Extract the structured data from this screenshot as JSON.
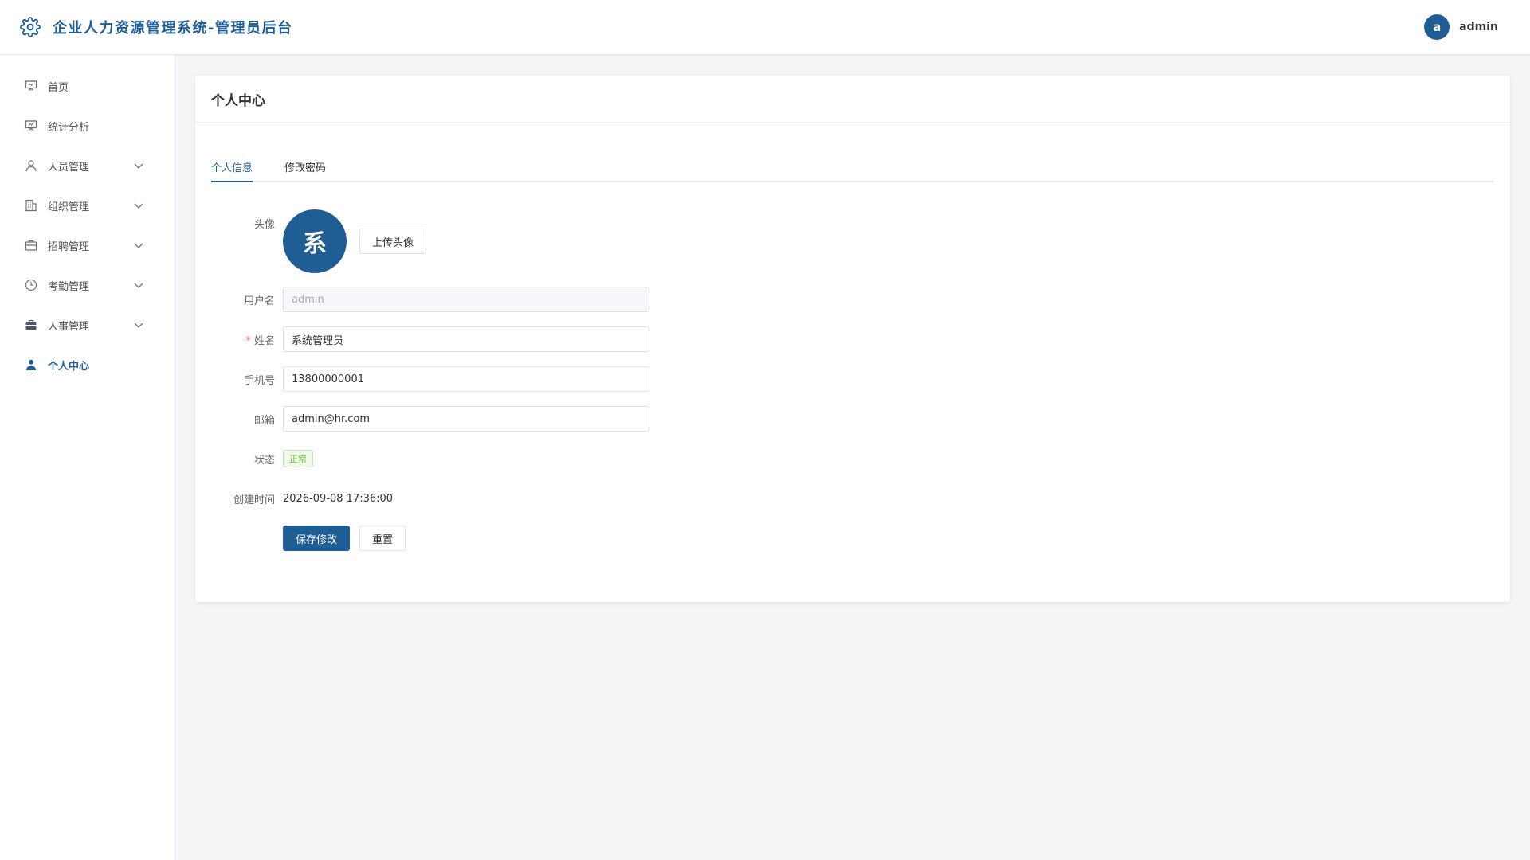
{
  "header": {
    "title": "企业人力资源管理系统-管理员后台",
    "logo_icon": "gear-icon",
    "user": {
      "avatar_letter": "a",
      "name": "admin"
    }
  },
  "sidebar": {
    "items": [
      {
        "label": "首页",
        "icon": "presentation-icon",
        "expandable": false
      },
      {
        "label": "统计分析",
        "icon": "presentation-chart-icon",
        "expandable": false
      },
      {
        "label": "人员管理",
        "icon": "user-icon",
        "expandable": true
      },
      {
        "label": "组织管理",
        "icon": "building-icon",
        "expandable": true
      },
      {
        "label": "招聘管理",
        "icon": "briefcase-icon",
        "expandable": true
      },
      {
        "label": "考勤管理",
        "icon": "clock-icon",
        "expandable": true
      },
      {
        "label": "人事管理",
        "icon": "toolbox-icon",
        "expandable": true
      },
      {
        "label": "个人中心",
        "icon": "user-filled-icon",
        "expandable": false,
        "active": true
      }
    ]
  },
  "card": {
    "title": "个人中心",
    "tabs": [
      {
        "label": "个人信息",
        "active": true
      },
      {
        "label": "修改密码",
        "active": false
      }
    ]
  },
  "form": {
    "avatar": {
      "label": "头像",
      "char": "系",
      "upload_button": "上传头像"
    },
    "username": {
      "label": "用户名",
      "value": "admin"
    },
    "name": {
      "label": "姓名",
      "required_mark": "*",
      "value": "系统管理员"
    },
    "phone": {
      "label": "手机号",
      "value": "13800000001"
    },
    "email": {
      "label": "邮箱",
      "value": "admin@hr.com"
    },
    "status": {
      "label": "状态",
      "value": "正常"
    },
    "created": {
      "label": "创建时间",
      "value": "2026-09-08 17:36:00"
    },
    "save_button": "保存修改",
    "reset_button": "重置"
  },
  "colors": {
    "primary": "#1f5d95",
    "success": "#67c23a",
    "danger": "#f56c6c"
  }
}
